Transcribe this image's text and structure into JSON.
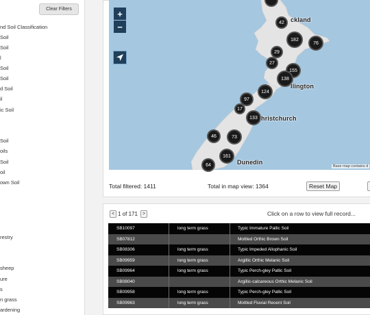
{
  "sidebar": {
    "clear_filters_label": "Clear Filters",
    "soil_items": [
      "nd Soil Classification",
      "Soil",
      " Soil",
      "l",
      "Soil",
      "Soil",
      "d Soil",
      "il",
      "ic Soil",
      "",
      "",
      "Soil",
      "oils",
      "Soil",
      "oil",
      "own Soil"
    ],
    "landuse_items": [
      "restry",
      "",
      "sheep",
      "ure",
      "s",
      "n grass",
      "ardening"
    ]
  },
  "map": {
    "zoom_in": "+",
    "zoom_out": "−",
    "clusters": [
      "42",
      "182",
      "76",
      "29",
      "27",
      "155",
      "138",
      "124",
      "97",
      "17",
      "133",
      "46",
      "73",
      "161",
      "64"
    ],
    "cities": [
      "ckland",
      "llington",
      "hristchurch",
      "Dunedin"
    ],
    "attribution": "Base map contains d"
  },
  "stats": {
    "total_filtered": "Total filtered: 1411",
    "total_in_view": "Total in map view: 1364",
    "reset_map_label": "Reset Map",
    "extra_button_label": "S"
  },
  "table": {
    "prev": "<",
    "next": ">",
    "page_text": "1 of 171",
    "hint": "Click on a row to view full record...",
    "rows": [
      {
        "id": "SB10097",
        "landuse": "long term grass",
        "soil": "Typic Immature Pallic Soil"
      },
      {
        "id": "SB07812",
        "landuse": "",
        "soil": "Mottled Orthic Brown Soil"
      },
      {
        "id": "SB08306",
        "landuse": "long term grass",
        "soil": "Typic Impeded Allophanic Soil"
      },
      {
        "id": "SB09959",
        "landuse": "long term grass",
        "soil": "Argillic Orthic Melanic Soil"
      },
      {
        "id": "SB09964",
        "landuse": "long term grass",
        "soil": "Typic Perch-gley Pallic Soil"
      },
      {
        "id": "SB08040",
        "landuse": "",
        "soil": "Argillic-calcareous Orthic Melanic Soil"
      },
      {
        "id": "SB09958",
        "landuse": "long term grass",
        "soil": "Typic Perch-gley Pallic Soil"
      },
      {
        "id": "SB09963",
        "landuse": "long term grass",
        "soil": "Mottled Fluvial Recent Soil"
      }
    ]
  },
  "colors": {
    "map_water": "#a5c7e0",
    "land": "#e4e4e4",
    "cluster": "#1a1a1a",
    "map_control": "#1f3f5b",
    "row_dark": "#050505",
    "row_grey": "#4a4a4a"
  },
  "icons": {
    "locate": "location-arrow-icon"
  }
}
